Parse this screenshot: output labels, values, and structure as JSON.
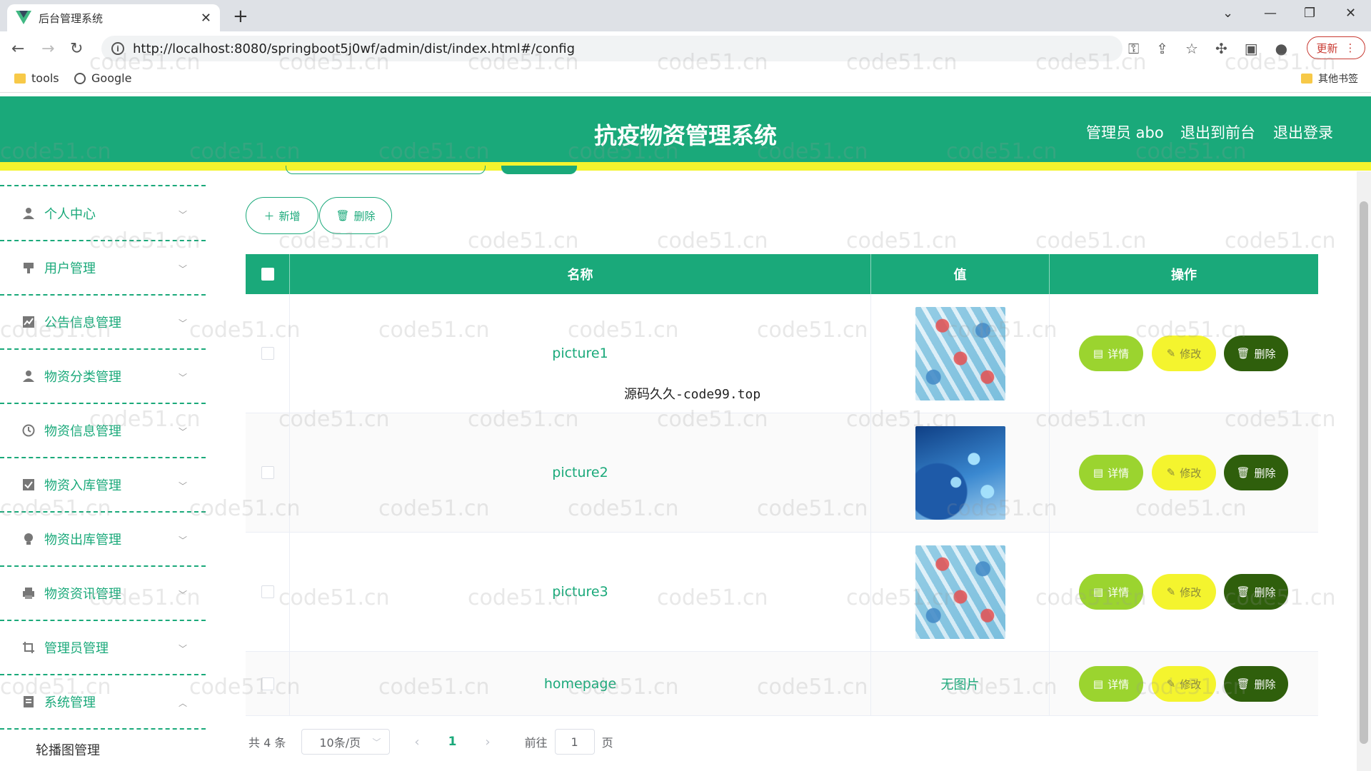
{
  "browser": {
    "tab_title": "后台管理系统",
    "url": "http://localhost:8080/springboot5j0wf/admin/dist/index.html#/config",
    "update_label": "更新",
    "bookmarks": [
      {
        "label": "tools",
        "icon": "folder-icon"
      },
      {
        "label": "Google",
        "icon": "globe-icon"
      }
    ],
    "other_bookmarks": "其他书签"
  },
  "header": {
    "title": "抗疫物资管理系统",
    "user": "管理员 abo",
    "front_link": "退出到前台",
    "logout": "退出登录"
  },
  "sidebar": {
    "items": [
      {
        "label": "个人中心",
        "icon": "person-icon"
      },
      {
        "label": "用户管理",
        "icon": "user-manage-icon"
      },
      {
        "label": "公告信息管理",
        "icon": "chart-icon"
      },
      {
        "label": "物资分类管理",
        "icon": "person-icon"
      },
      {
        "label": "物资信息管理",
        "icon": "clock-icon"
      },
      {
        "label": "物资入库管理",
        "icon": "checkbox-icon"
      },
      {
        "label": "物资出库管理",
        "icon": "bulb-icon"
      },
      {
        "label": "物资资讯管理",
        "icon": "printer-icon"
      },
      {
        "label": "管理员管理",
        "icon": "crop-icon"
      },
      {
        "label": "系统管理",
        "icon": "doc-icon"
      }
    ],
    "sub_item": "轮播图管理"
  },
  "toolbar": {
    "add_label": "新增",
    "delete_label": "删除"
  },
  "table": {
    "columns": [
      "名称",
      "值",
      "操作"
    ],
    "rows": [
      {
        "name": "picture1",
        "value_type": "image",
        "image": "medical-icons-image"
      },
      {
        "name": "picture2",
        "value_type": "image",
        "image": "doctor-tablet-image"
      },
      {
        "name": "picture3",
        "value_type": "image",
        "image": "medical-icons-image"
      },
      {
        "name": "homepage",
        "value_type": "text",
        "value": "无图片"
      }
    ],
    "op_detail": "详情",
    "op_edit": "修改",
    "op_delete": "删除"
  },
  "overlay_text": "源码久久-code99.top",
  "pagination": {
    "total": "共 4 条",
    "page_size": "10条/页",
    "current_page": "1",
    "goto_prefix": "前往",
    "goto_value": "1",
    "goto_suffix": "页"
  },
  "watermark": "code51.cn",
  "colors": {
    "primary": "#1aa97a",
    "accent_yellow": "#f4f42e",
    "detail_green": "#9bd42f",
    "delete_dark": "#2f5f0c"
  }
}
